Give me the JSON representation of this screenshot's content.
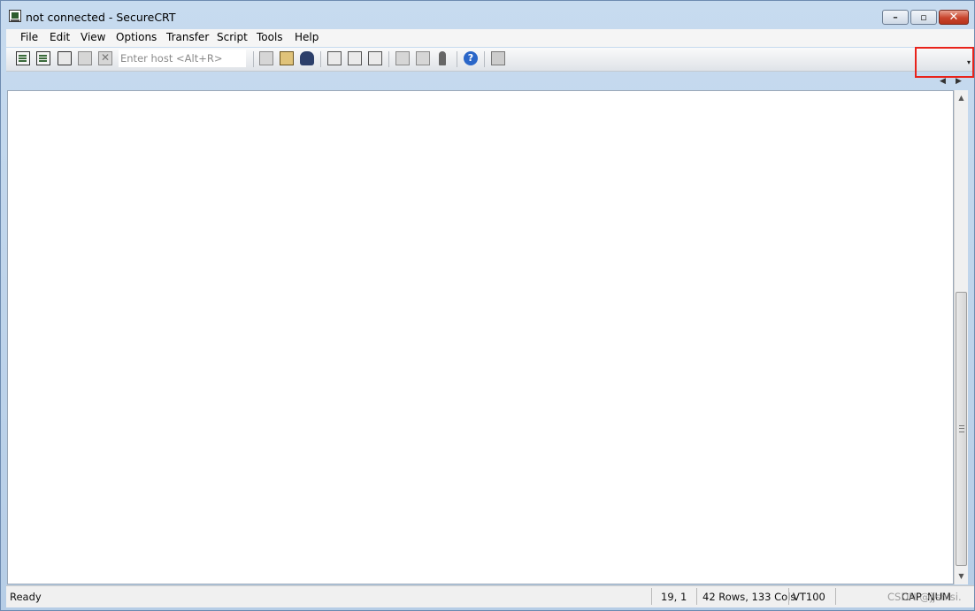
{
  "window": {
    "title": "not connected - SecureCRT",
    "minimize_glyph": "–",
    "maximize_glyph": "▫",
    "close_glyph": "✕"
  },
  "menu": {
    "items": [
      "File",
      "Edit",
      "View",
      "Options",
      "Transfer",
      "Script",
      "Tools",
      "Help"
    ]
  },
  "toolbar": {
    "host_placeholder": "Enter host <Alt+R>",
    "icons": [
      "connect-icon",
      "quick-connect-icon",
      "connect-tab-icon",
      "reconnect-icon",
      "disconnect-icon",
      "copy-icon",
      "paste-icon",
      "find-icon",
      "print-screen-icon",
      "print-selection-icon",
      "printer-icon",
      "sftp-icon",
      "session-options-icon",
      "keymap-icon",
      "help-icon",
      "map-icon"
    ],
    "dropdown_glyph": "▾"
  },
  "tabs": {
    "left_glyph": "◀",
    "right_glyph": "▶"
  },
  "scrollbar": {
    "up_glyph": "▲",
    "down_glyph": "▼"
  },
  "status": {
    "ready": "Ready",
    "cursor": "19,  1",
    "size": "42 Rows, 133 Cols",
    "emulation": "VT100",
    "caps": "CAP",
    "num": "NUM"
  },
  "watermark": "CSDN @jjshisi."
}
